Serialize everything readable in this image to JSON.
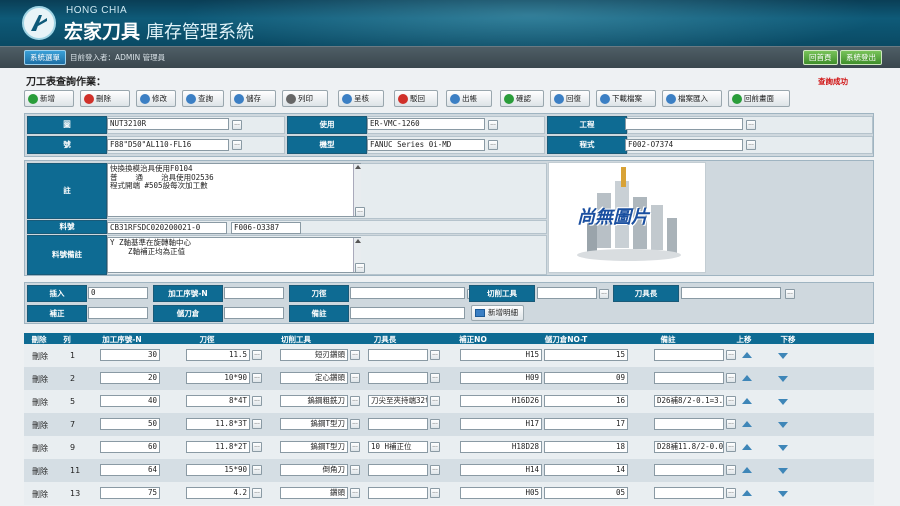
{
  "brand": {
    "en": "HONG CHIA",
    "zh": "宏家刀具",
    "system_title": "庫存管理系統"
  },
  "subbar": {
    "menu_label": "系統選單",
    "login_info": "目前登入者：ADMIN 管理員",
    "home_label": "回首頁",
    "logout_label": "系統登出"
  },
  "page": {
    "title": "刀工表查詢作業：",
    "status": "查詢成功"
  },
  "toolbar": [
    {
      "label": "新增",
      "icon": "add-icon",
      "color": "#2a9d3a"
    },
    {
      "label": "刪除",
      "icon": "delete-icon",
      "color": "#d0302a"
    },
    {
      "label": "修改",
      "icon": "edit-icon",
      "color": "#3b7fc4"
    },
    {
      "label": "查詢",
      "icon": "search-icon",
      "color": "#3b7fc4"
    },
    {
      "label": "儲存",
      "icon": "save-icon",
      "color": "#3b7fc4"
    },
    {
      "label": "列印",
      "icon": "print-icon",
      "color": "#666666"
    },
    {
      "label": "呈核",
      "icon": "submit-icon",
      "color": "#3b7fc4"
    },
    {
      "label": "駁回",
      "icon": "reject-icon",
      "color": "#d0302a"
    },
    {
      "label": "出帳",
      "icon": "checkout-icon",
      "color": "#3b7fc4"
    },
    {
      "label": "確認",
      "icon": "confirm-icon",
      "color": "#2a9d3a"
    },
    {
      "label": "回復",
      "icon": "restore-icon",
      "color": "#3b7fc4"
    },
    {
      "label": "下載檔案",
      "icon": "download-icon",
      "color": "#3b7fc4"
    },
    {
      "label": "檔案匯入",
      "icon": "import-icon",
      "color": "#3b7fc4"
    },
    {
      "label": "回前畫面",
      "icon": "back-icon",
      "color": "#2a9d3a"
    }
  ],
  "form1": {
    "drawing_label": "圖",
    "drawing_value": "NUT3210R",
    "usage_label": "使用",
    "usage_value": "ER-VMC-1260",
    "process_label": "工程",
    "process_value": "",
    "number_label": "號",
    "number_value": "F88\"D50\"AL110-FL16",
    "machine_label": "機型",
    "machine_value": "FANUC Series 0i-MD",
    "program_label": "程式",
    "program_value": "F002-O7374"
  },
  "form2": {
    "note_label": "註",
    "note_value": "快換換模治具使用F0104\n普    通    治具使用O2536\n程式開端 #505設每次加工數",
    "material_label": "料號",
    "material_value": "CB31RFSDC020200021-0",
    "material_value2": "F006-O3387",
    "material_note_label": "料號備註",
    "material_note_value": "Y Z軸基準在旋轉軸中心\n    Z軸補正均為正值",
    "image_caption": "尚無圖片"
  },
  "form3": {
    "insert_label": "插入",
    "insert_value": "0",
    "seq_label": "加工序號-N",
    "seq_value": "",
    "diameter_label": "刀徑",
    "diameter_value": "",
    "cutting_tool_label": "切削工具",
    "cutting_tool_value": "",
    "tool_length_label": "刀具長",
    "tool_length_value": "",
    "compensation_label": "補正",
    "compensation_value": "",
    "storage_label": "儲刀倉",
    "storage_value": "",
    "remark_label": "備註",
    "remark_value": "",
    "add_detail_label": "新增明細"
  },
  "table": {
    "headers": [
      "刪除",
      "列",
      "加工序號-N",
      "刀徑",
      "切削工具",
      "刀具長",
      "補正NO",
      "儲刀倉NO-T",
      "備註",
      "上移",
      "下移"
    ],
    "rows": [
      {
        "del": "刪除",
        "n": "1",
        "seq": "30",
        "dia": "11.5",
        "tool": "短刃鑽頭",
        "len": "",
        "comp": "H15",
        "store": "15",
        "remark": ""
      },
      {
        "del": "刪除",
        "n": "2",
        "seq": "20",
        "dia": "10*90",
        "tool": "定心鑽頭",
        "len": "",
        "comp": "H09",
        "store": "09",
        "remark": ""
      },
      {
        "del": "刪除",
        "n": "5",
        "seq": "40",
        "dia": "8*4T",
        "tool": "鎢鋼粗銑刀",
        "len": "刀尖至夾持端32t",
        "comp": "H16D26",
        "store": "16",
        "remark": "D26補8/2-0.1=3."
      },
      {
        "del": "刪除",
        "n": "7",
        "seq": "50",
        "dia": "11.8*3T",
        "tool": "鎢鋼T型刀",
        "len": "",
        "comp": "H17",
        "store": "17",
        "remark": ""
      },
      {
        "del": "刪除",
        "n": "9",
        "seq": "60",
        "dia": "11.8*2T",
        "tool": "鎢鋼T型刀",
        "len": "10    H補正位",
        "comp": "H18D28",
        "store": "18",
        "remark": "D28補11.8/2-0.0"
      },
      {
        "del": "刪除",
        "n": "11",
        "seq": "64",
        "dia": "15*90",
        "tool": "倒角刀",
        "len": "",
        "comp": "H14",
        "store": "14",
        "remark": ""
      },
      {
        "del": "刪除",
        "n": "13",
        "seq": "75",
        "dia": "4.2",
        "tool": "鑽頭",
        "len": "",
        "comp": "H05",
        "store": "05",
        "remark": ""
      }
    ]
  }
}
